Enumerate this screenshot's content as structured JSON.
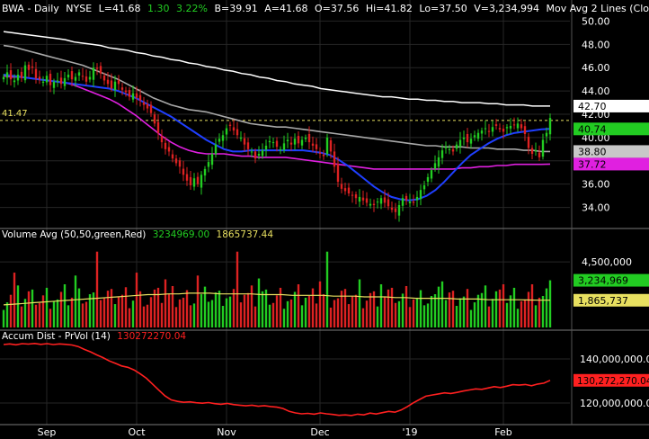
{
  "header": {
    "ticker": "BWA",
    "period": "Daily",
    "exchange": "NYSE",
    "last": "L=41.68",
    "change": "1.30",
    "change_pct": "3.22%",
    "bid": "B=39.91",
    "ask": "A=41.68",
    "open": "O=37.56",
    "high": "Hi=41.82",
    "low": "Lo=37.50",
    "volume": "V=3,234,994",
    "study": "Mov Avg 2 Lines (Clos"
  },
  "colors": {
    "background": "#000000",
    "up": "#22cc22",
    "down": "#dd2222",
    "ma_fast": "#1f3fff",
    "ma_mid": "#e020e0",
    "ma_slow": "#a8a8a8",
    "ma_long": "#ffffff",
    "vol_avg": "#e8e060",
    "accum": "#ff2020",
    "reference": "#e8e060"
  },
  "chart_data": [
    {
      "type": "candlestick",
      "panel": "price",
      "y_axis_ticks": [
        "50.00",
        "48.00",
        "46.00",
        "44.00",
        "42.00",
        "40.00",
        "38.00",
        "36.00",
        "34.00"
      ],
      "ylim": [
        32.5,
        51.5
      ],
      "reference_line": {
        "label": "41.47",
        "value": 41.47
      },
      "price_badges": [
        {
          "label": "42.70",
          "value": 42.7,
          "bg": "#ffffff",
          "fg": "#000000"
        },
        {
          "label": "40.74",
          "value": 40.74,
          "bg": "#22cc22",
          "fg": "#000000"
        },
        {
          "label": "38.80",
          "value": 38.8,
          "bg": "#c8c8c8",
          "fg": "#000000"
        },
        {
          "label": "37.72",
          "value": 37.72,
          "bg": "#e020e0",
          "fg": "#000000"
        }
      ],
      "x_labels": [
        "Sep",
        "Oct",
        "Nov",
        "Dec",
        "'19",
        "Feb"
      ],
      "closes": [
        45.2,
        45.6,
        45.0,
        44.9,
        45.4,
        45.1,
        46.2,
        45.8,
        46.0,
        45.1,
        45.0,
        44.8,
        45.3,
        44.5,
        44.8,
        44.9,
        44.6,
        45.1,
        45.4,
        45.0,
        45.2,
        45.6,
        45.3,
        44.8,
        45.2,
        46.0,
        45.9,
        45.5,
        44.9,
        44.6,
        44.2,
        44.8,
        44.6,
        44.1,
        43.9,
        43.5,
        43.8,
        43.4,
        43.2,
        42.8,
        42.5,
        42.1,
        41.2,
        40.4,
        39.6,
        39.0,
        38.8,
        38.2,
        37.8,
        37.5,
        36.8,
        36.3,
        35.9,
        36.5,
        36.0,
        36.8,
        37.3,
        37.9,
        38.6,
        39.4,
        39.9,
        40.2,
        40.8,
        41.0,
        40.6,
        40.2,
        40.0,
        39.4,
        39.0,
        38.8,
        38.2,
        38.6,
        38.9,
        39.3,
        39.7,
        39.6,
        39.2,
        39.0,
        39.5,
        39.8,
        39.4,
        39.9,
        39.5,
        39.8,
        40.0,
        39.6,
        39.3,
        39.0,
        38.6,
        38.4,
        40.0,
        38.8,
        37.5,
        36.2,
        35.6,
        35.4,
        35.2,
        35.0,
        34.8,
        34.9,
        34.6,
        34.4,
        34.3,
        34.2,
        34.5,
        34.8,
        34.4,
        34.1,
        33.8,
        33.6,
        34.2,
        34.8,
        34.6,
        34.5,
        34.4,
        34.9,
        35.5,
        35.9,
        36.6,
        37.2,
        37.8,
        38.3,
        38.9,
        39.2,
        39.0,
        38.8,
        39.4,
        39.8,
        40.0,
        39.6,
        39.9,
        40.2,
        40.4,
        40.6,
        40.8,
        40.5,
        40.9,
        41.0,
        40.7,
        40.5,
        40.9,
        41.0,
        41.1,
        41.2,
        40.8,
        40.3,
        39.1,
        38.6,
        38.9,
        38.3,
        39.8,
        40.4,
        41.68
      ],
      "series": [
        {
          "name": "MA fast",
          "values": [
            45.4,
            45.3,
            45.2,
            45.1,
            45.0,
            44.9,
            44.8,
            44.7,
            44.6,
            44.5,
            44.4,
            44.3,
            44.2,
            44.0,
            43.7,
            43.4,
            43.0,
            42.6,
            42.2,
            41.8,
            41.3,
            40.8,
            40.3,
            39.8,
            39.4,
            39.0,
            38.8,
            38.8,
            38.9,
            38.9,
            38.9,
            38.9,
            38.9,
            38.9,
            38.9,
            38.8,
            38.7,
            38.5,
            38.1,
            37.6,
            37.0,
            36.4,
            35.8,
            35.3,
            34.9,
            34.7,
            34.6,
            34.7,
            35.0,
            35.5,
            36.2,
            37.0,
            37.8,
            38.5,
            39.0,
            39.5,
            39.9,
            40.2,
            40.4,
            40.5,
            40.6,
            40.7,
            40.74
          ]
        },
        {
          "name": "MA mid",
          "values": [
            45.3,
            45.2,
            45.2,
            45.1,
            45.0,
            44.9,
            44.8,
            44.7,
            44.5,
            44.2,
            43.9,
            43.6,
            43.3,
            42.9,
            42.4,
            41.9,
            41.3,
            40.7,
            40.1,
            39.6,
            39.2,
            38.9,
            38.7,
            38.6,
            38.6,
            38.6,
            38.5,
            38.4,
            38.4,
            38.3,
            38.3,
            38.3,
            38.3,
            38.2,
            38.1,
            38.0,
            37.9,
            37.8,
            37.7,
            37.6,
            37.5,
            37.4,
            37.3,
            37.3,
            37.3,
            37.3,
            37.3,
            37.3,
            37.3,
            37.3,
            37.3,
            37.3,
            37.4,
            37.4,
            37.5,
            37.5,
            37.6,
            37.6,
            37.7,
            37.7,
            37.7,
            37.7,
            37.72
          ]
        },
        {
          "name": "MA slow",
          "values": [
            47.9,
            47.8,
            47.6,
            47.4,
            47.2,
            47.0,
            46.8,
            46.6,
            46.4,
            46.2,
            45.9,
            45.6,
            45.3,
            45.0,
            44.6,
            44.2,
            43.8,
            43.4,
            43.1,
            42.8,
            42.6,
            42.4,
            42.3,
            42.2,
            42.0,
            41.8,
            41.6,
            41.4,
            41.2,
            41.1,
            41.0,
            40.9,
            40.9,
            40.8,
            40.7,
            40.6,
            40.5,
            40.4,
            40.3,
            40.2,
            40.1,
            40.0,
            39.9,
            39.8,
            39.7,
            39.6,
            39.5,
            39.4,
            39.3,
            39.3,
            39.2,
            39.2,
            39.2,
            39.1,
            39.1,
            39.1,
            39.0,
            39.0,
            39.0,
            38.9,
            38.9,
            38.8,
            38.8
          ]
        },
        {
          "name": "MA long",
          "values": [
            49.1,
            49.0,
            48.9,
            48.8,
            48.7,
            48.6,
            48.5,
            48.4,
            48.2,
            48.1,
            48.0,
            47.9,
            47.7,
            47.6,
            47.5,
            47.3,
            47.2,
            47.0,
            46.9,
            46.7,
            46.6,
            46.4,
            46.3,
            46.1,
            46.0,
            45.8,
            45.7,
            45.5,
            45.4,
            45.2,
            45.1,
            44.9,
            44.8,
            44.6,
            44.5,
            44.4,
            44.2,
            44.1,
            44.0,
            43.9,
            43.8,
            43.7,
            43.6,
            43.5,
            43.5,
            43.4,
            43.3,
            43.3,
            43.2,
            43.2,
            43.1,
            43.1,
            43.0,
            43.0,
            43.0,
            42.9,
            42.9,
            42.8,
            42.8,
            42.8,
            42.7,
            42.7,
            42.7
          ]
        }
      ]
    },
    {
      "type": "bar",
      "panel": "volume",
      "title": "Volume Avg (50,50,green,Red)",
      "values_text": [
        "3234969.00",
        "1865737.44"
      ],
      "y_axis_ticks": [
        "4,500,000"
      ],
      "ylim": [
        0,
        5800000
      ],
      "badges": [
        {
          "label": "3,234,969",
          "value": 3234969,
          "bg": "#22cc22",
          "fg": "#000000"
        },
        {
          "label": "1,865,737",
          "value": 1865737,
          "bg": "#e8e060",
          "fg": "#000000"
        }
      ],
      "avg_values": [
        1.55,
        1.6,
        1.65,
        1.7,
        1.75,
        1.8,
        1.85,
        1.9,
        1.95,
        2.0,
        2.05,
        2.1,
        2.15,
        2.2,
        2.25,
        2.25,
        2.3,
        2.3,
        2.35,
        2.35,
        2.35,
        2.3,
        2.3,
        2.3,
        2.3,
        2.25,
        2.25,
        2.25,
        2.2,
        2.2,
        2.2,
        2.2,
        2.15,
        2.15,
        2.15,
        2.1,
        2.1,
        2.1,
        2.05,
        2.05,
        2.0,
        2.0,
        2.0,
        2.0,
        1.95,
        1.95,
        1.95,
        1.9,
        1.9,
        1.9,
        1.9,
        1.88,
        1.87,
        1.87
      ]
    },
    {
      "type": "line",
      "panel": "accum_dist",
      "title": "Accum Dist - PrVol (14)",
      "values_text": [
        "130272270.04"
      ],
      "y_axis_ticks": [
        "140,000,000.00",
        "120,000,000.00"
      ],
      "ylim": [
        111000000,
        151000000
      ],
      "badges": [
        {
          "label": "130,272,270.04",
          "value": 130272270.04,
          "bg": "#ff2020",
          "fg": "#000000"
        }
      ],
      "series": [
        {
          "name": "Accum Dist",
          "values": [
            146.5,
            146.8,
            146.4,
            146.9,
            146.7,
            147.0,
            146.6,
            146.9,
            146.5,
            146.8,
            146.6,
            146.3,
            145.6,
            144.3,
            143.2,
            141.8,
            140.6,
            139.1,
            138.0,
            136.8,
            136.2,
            135.0,
            133.2,
            131.2,
            128.5,
            125.8,
            123.2,
            121.4,
            120.7,
            120.3,
            120.5,
            120.1,
            119.9,
            120.2,
            119.7,
            119.4,
            119.8,
            119.3,
            119.0,
            118.7,
            119.0,
            118.5,
            118.8,
            118.4,
            118.1,
            117.5,
            116.2,
            115.5,
            115.1,
            115.3,
            114.9,
            115.5,
            115.1,
            114.8,
            114.4,
            114.6,
            114.3,
            114.9,
            114.6,
            115.4,
            115.0,
            115.6,
            116.2,
            115.8,
            116.8,
            118.3,
            120.1,
            121.6,
            123.1,
            123.6,
            124.1,
            124.6,
            124.3,
            124.8,
            125.4,
            125.9,
            126.4,
            126.2,
            126.8,
            127.4,
            127.0,
            127.6,
            128.3,
            128.1,
            128.4,
            127.8,
            128.6,
            129.0,
            130.27
          ]
        }
      ]
    }
  ]
}
